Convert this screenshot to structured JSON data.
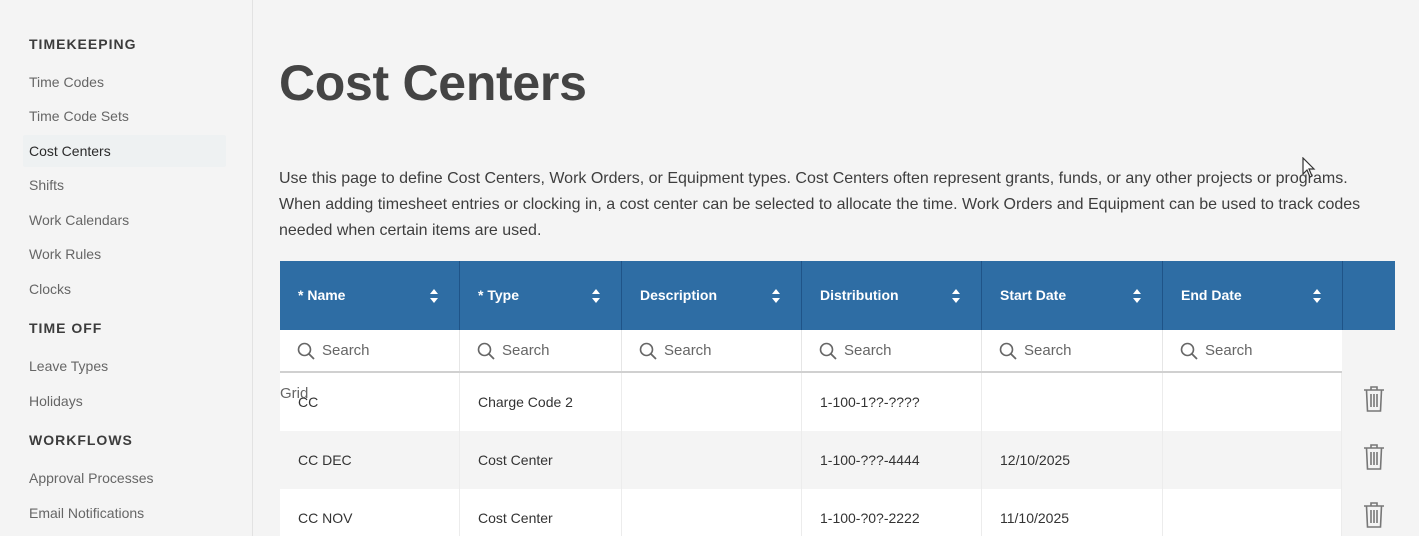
{
  "sidebar": {
    "sections": [
      {
        "heading": "TIMEKEEPING",
        "items": [
          "Time Codes",
          "Time Code Sets",
          "Cost Centers",
          "Shifts",
          "Work Calendars",
          "Work Rules",
          "Clocks"
        ]
      },
      {
        "heading": "TIME OFF",
        "items": [
          "Leave Types",
          "Holidays"
        ]
      },
      {
        "heading": "WORKFLOWS",
        "items": [
          "Approval Processes",
          "Email Notifications"
        ]
      }
    ],
    "active_item": "Cost Centers"
  },
  "page": {
    "title": "Cost Centers",
    "description": "Use this page to define Cost Centers, Work Orders, or Equipment types. Cost Centers often represent grants, funds, or any other projects or programs. When adding timesheet entries or clocking in, a cost center can be selected to allocate the time. Work Orders and Equipment can be used to track codes needed when certain items are used."
  },
  "table": {
    "columns": [
      "* Name",
      "* Type",
      "Description",
      "Distribution",
      "Start Date",
      "End Date"
    ],
    "search_placeholder": "Search",
    "overlay_label": "Grid",
    "rows": [
      [
        "CC",
        "Charge Code 2",
        "",
        "1-100-1??-????",
        "",
        ""
      ],
      [
        "CC DEC",
        "Cost Center",
        "",
        "1-100-???-4444",
        "12/10/2025",
        ""
      ],
      [
        "CC NOV",
        "Cost Center",
        "",
        "1-100-?0?-2222",
        "11/10/2025",
        ""
      ]
    ]
  },
  "colors": {
    "header_bg": "#2e6da4",
    "page_bg": "#f4f4f4",
    "active_nav_bg": "#eef1f2"
  },
  "icons": [
    "sort-icon",
    "search-icon",
    "trash-icon",
    "mouse-cursor-icon"
  ]
}
